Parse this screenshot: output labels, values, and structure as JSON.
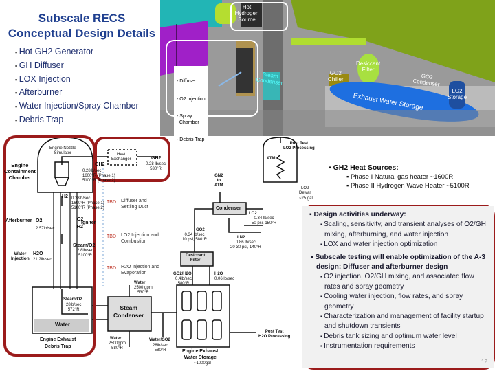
{
  "title": "Subscale RECS\nConceptual Design Details",
  "bullets": [
    "Hot GH2 Generator",
    "GH Diffuser",
    "LOX Injection",
    "Afterburner",
    "Water Injection/Spray Chamber",
    "Debris Trap"
  ],
  "photo": {
    "hot_hydrogen": "Hot\nHydrogen\nSource",
    "callout": [
      "- Diffuser",
      "- O2 Injection",
      "- Spray\n  Chamber",
      "- Debris Trap"
    ],
    "steam_condenser": "Steam\nCondenser",
    "go2_chiller": "GO2\nChiller",
    "desiccant": "Desiccant\nFilter",
    "go2_condenser": "GO2\nCondenser",
    "lo2_storage": "LO2\nStorage",
    "exhaust_tank": "Exhaust Water Storage"
  },
  "diagram": {
    "nozzle": "Engine Nozzle\nSimulator",
    "containment": "Engine\nContainment\nChamber",
    "heat_exchanger": "Heat\nExchanger",
    "gh2_in": "GH2",
    "gh2_in_flow": "0.28 lb/sec\n530°R",
    "gh2_out": "GH2",
    "gh2_out_flow": "0.28lb/sec\n1600°R (Phase 1)\n5100°R (Phase 2)",
    "h2": "H2",
    "h2_flow": "0.28lb/sec\n1600°R (Phase 1)\n5100°R (Phase 2)",
    "afterburner": "Afterburner",
    "o2": "O2",
    "o2_flow": "2.57lb/sec",
    "igniter": "Igniter",
    "ign_o2": "O2",
    "ign_h2": "H2",
    "steam_o2": "Steam/O2",
    "steam_o2_flow": "2.8lb/sec\n5100°R",
    "water_injection": "Water\nInjection",
    "h2o": "H2O",
    "h2o_flow": "21.2lb/sec",
    "tbd": "TBD",
    "tbd1": "Diffuser and\nSettling Duct",
    "tbd2": "LO2 Injection and\nCombustion",
    "tbd3": "H2O Injection and\nEvaporation",
    "trap_steam": "Steam/O2",
    "trap_steam_flow": "28lb/sec\n572°R",
    "water": "Water",
    "debris_trap": "Engine Exhaust\nDebris Trap",
    "steam_condenser": "Steam\nCondenser",
    "water_in": "Water",
    "water_in_flow": "2500 gpm\n530°R",
    "water_out": "Water",
    "water_out_flow": "2500gpm\n580°R",
    "water_go2": "Water/GO2",
    "water_go2_flow": "28lb/sec\n580°R",
    "desiccant": "Desiccant\nFilter",
    "go2": "GO2",
    "go2_flow": "0.34 lb/sec\n10 psi, 580°R",
    "condenser": "Condenser",
    "gn2": "GN2\nto\nATM",
    "lo2": "LO2",
    "lo2_flow": "0.34 lb/sec\n50 psi, 150°R",
    "ln2": "LN2",
    "ln2_flow": "0.86 lb/sec\n20-30 psi, 140°R",
    "go2_h2o": "GO2/H2O",
    "go2_h2o_flow": "0.4lb/sec\n580°R",
    "h2o_drain": "H2O",
    "h2o_drain_flow": "0.06 lb/sec",
    "storage": "Engine Exhaust\nWater Storage",
    "storage_cap": "~1000gal",
    "post_h2o": "Post Test\nH2O Processing",
    "post_lo2": "Post Test\nLO2 Processing",
    "atm": "ATM",
    "dewar": "LO2\nDewar",
    "dewar_cap": "~25 gal"
  },
  "heat_sources": {
    "head": "GH2 Heat Sources:",
    "items": [
      "Phase I Natural gas heater ~1600R",
      "Phase II Hydrogen Wave Heater ~5100R"
    ]
  },
  "design": {
    "head1": "Design activities underway:",
    "items1": [
      "Scaling, sensitivity, and transient analyses of O2/GH mixing, afterburning, and water injection",
      "LOX and water injection optimization"
    ],
    "head2": "Subscale testing will enable optimization of the A-3 design: Diffuser and afterburner design",
    "items2": [
      "O2 injection, O2/GH mixing, and associated flow rates and spray geometry",
      "Cooling water injection, flow rates, and spray geometry",
      "Characterization and management of facility startup and shutdown transients",
      "Debris tank sizing and optimum water level",
      "Instrumentation requirements"
    ]
  },
  "page_number": "12",
  "colors": {
    "title": "#1f3f8f",
    "border": "#9b1b1b",
    "tbd": "#c0392b",
    "tank": "#1e6fe0"
  }
}
